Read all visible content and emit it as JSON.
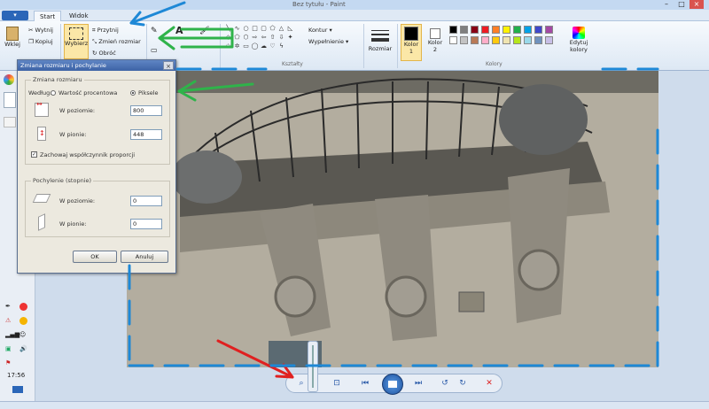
{
  "window": {
    "title": "Bez tytułu - Paint"
  },
  "tabs": [
    {
      "label": "Start"
    },
    {
      "label": "Widok"
    }
  ],
  "ribbon": {
    "clipboard": {
      "paste_label": "Wklej",
      "cut_label": "Wytnij",
      "copy_label": "Kopiuj"
    },
    "image": {
      "select_label": "Wybierz",
      "crop_label": "Przytnij",
      "resize_label": "Zmień rozmiar",
      "rotate_label": "Obróć"
    },
    "shapes": {
      "outline_label": "Kontur",
      "fill_label": "Wypełnienie",
      "group_label": "Kształty"
    },
    "size_label": "Rozmiar",
    "color1_label": "Kolor 1",
    "color2_label": "Kolor 2",
    "edit_colors_label": "Edytuj kolory",
    "colors_group_label": "Kolory",
    "palette": [
      "#000000",
      "#7f7f7f",
      "#880015",
      "#ed1c24",
      "#ff7f27",
      "#fff200",
      "#22b14c",
      "#00a2e8",
      "#3f48cc",
      "#a349a4",
      "#ffffff",
      "#c3c3c3",
      "#b97a57",
      "#ffaec9",
      "#ffc90e",
      "#efe4b0",
      "#b5e61d",
      "#99d9ea",
      "#7092be",
      "#c8bfe7"
    ]
  },
  "dialog": {
    "title": "Zmiana rozmiaru i pochylanie",
    "resize": {
      "legend": "Zmiana rozmiaru",
      "by_label": "Według:",
      "percent_label": "Wartość procentowa",
      "pixels_label": "Piksele",
      "horizontal_label": "W poziomie:",
      "horizontal_value": "800",
      "vertical_label": "W pionie:",
      "vertical_value": "448",
      "keep_ratio_label": "Zachowaj współczynnik proporcji",
      "keep_ratio_checked": true
    },
    "skew": {
      "legend": "Pochylenie (stopnie)",
      "horizontal_label": "W poziomie:",
      "horizontal_value": "0",
      "vertical_label": "W pionie:",
      "vertical_value": "0"
    },
    "ok_label": "OK",
    "cancel_label": "Anuluj"
  },
  "taskbar": {
    "clock": "17:56"
  },
  "colors": {
    "annotation_blue": "#1e88d6",
    "annotation_green": "#2fb34a",
    "annotation_red": "#e02020"
  }
}
